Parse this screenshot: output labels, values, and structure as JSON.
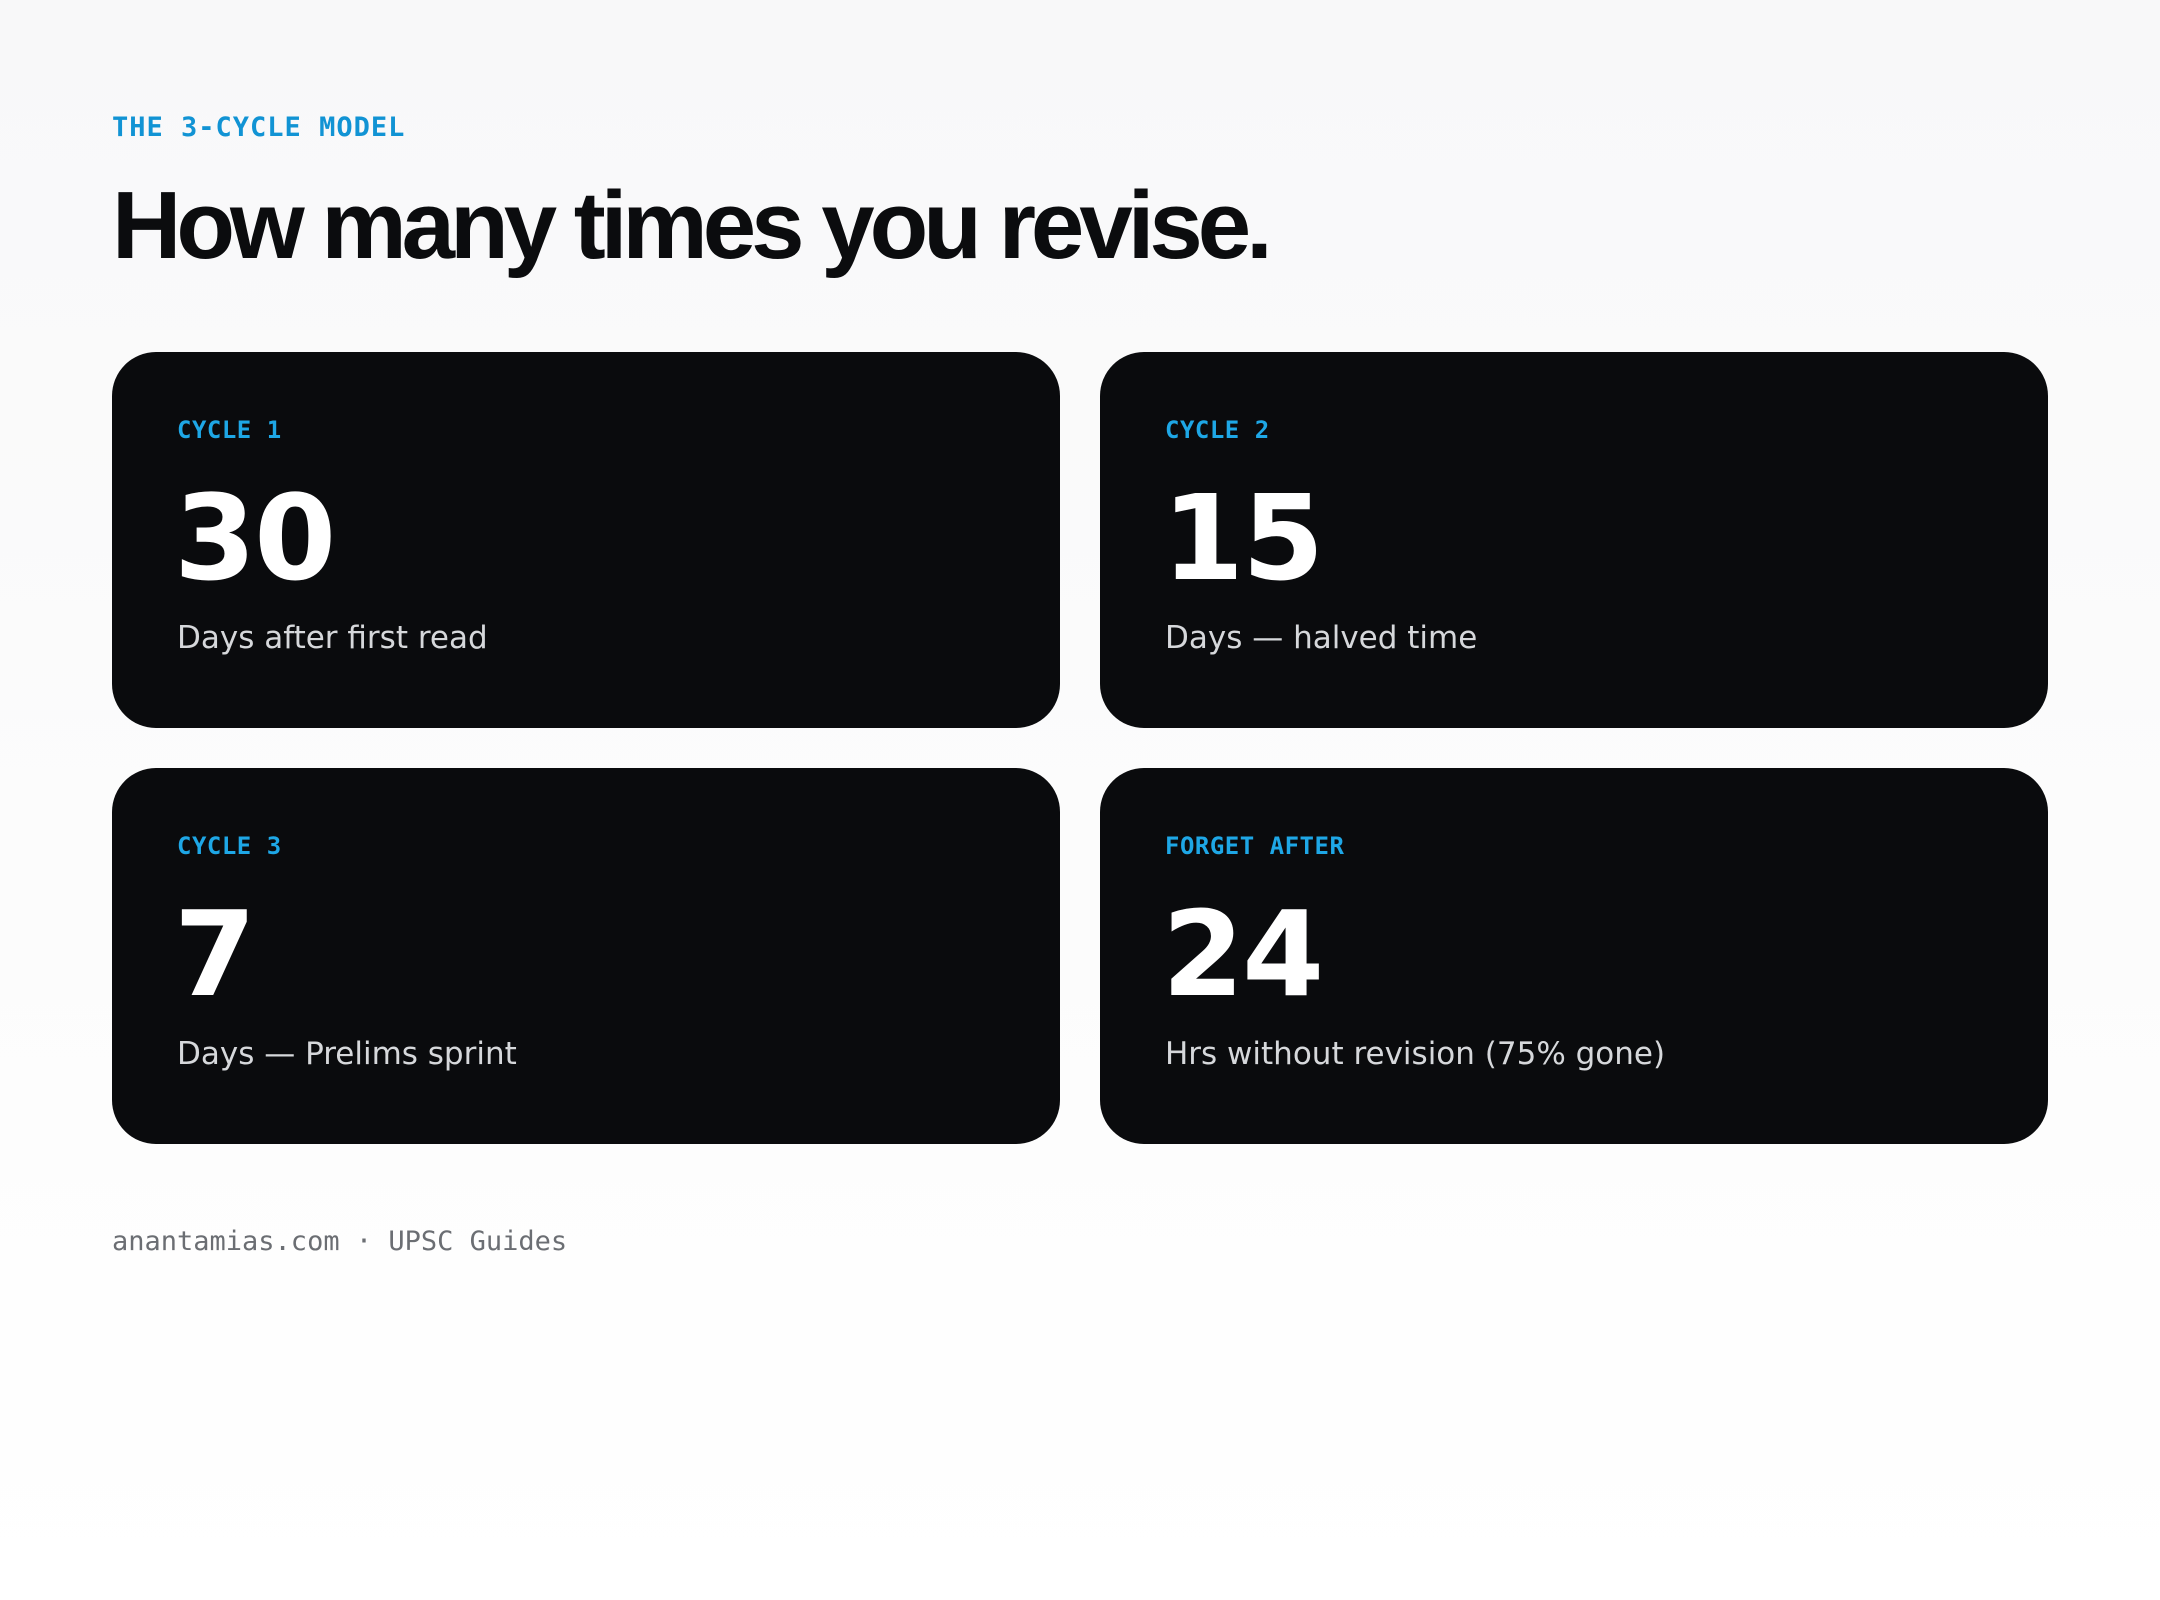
{
  "header": {
    "eyebrow": "THE 3-CYCLE MODEL",
    "title": "How many times you revise."
  },
  "cards": [
    {
      "label": "CYCLE 1",
      "value": "30",
      "caption": "Days after first read"
    },
    {
      "label": "CYCLE 2",
      "value": "15",
      "caption": "Days — halved time"
    },
    {
      "label": "CYCLE 3",
      "value": "7",
      "caption": "Days — Prelims sprint"
    },
    {
      "label": "FORGET AFTER",
      "value": "24",
      "caption": "Hrs without revision (75% gone)"
    }
  ],
  "footer": {
    "site": "anantamias.com",
    "separator": "·",
    "section": "UPSC Guides"
  },
  "colors": {
    "accent": "#1193d4",
    "card_label": "#1ea7e6",
    "card_background": "#0a0b0d",
    "card_caption": "#d6d8db",
    "title": "#0b0c0e",
    "footer": "#6b6e73"
  }
}
